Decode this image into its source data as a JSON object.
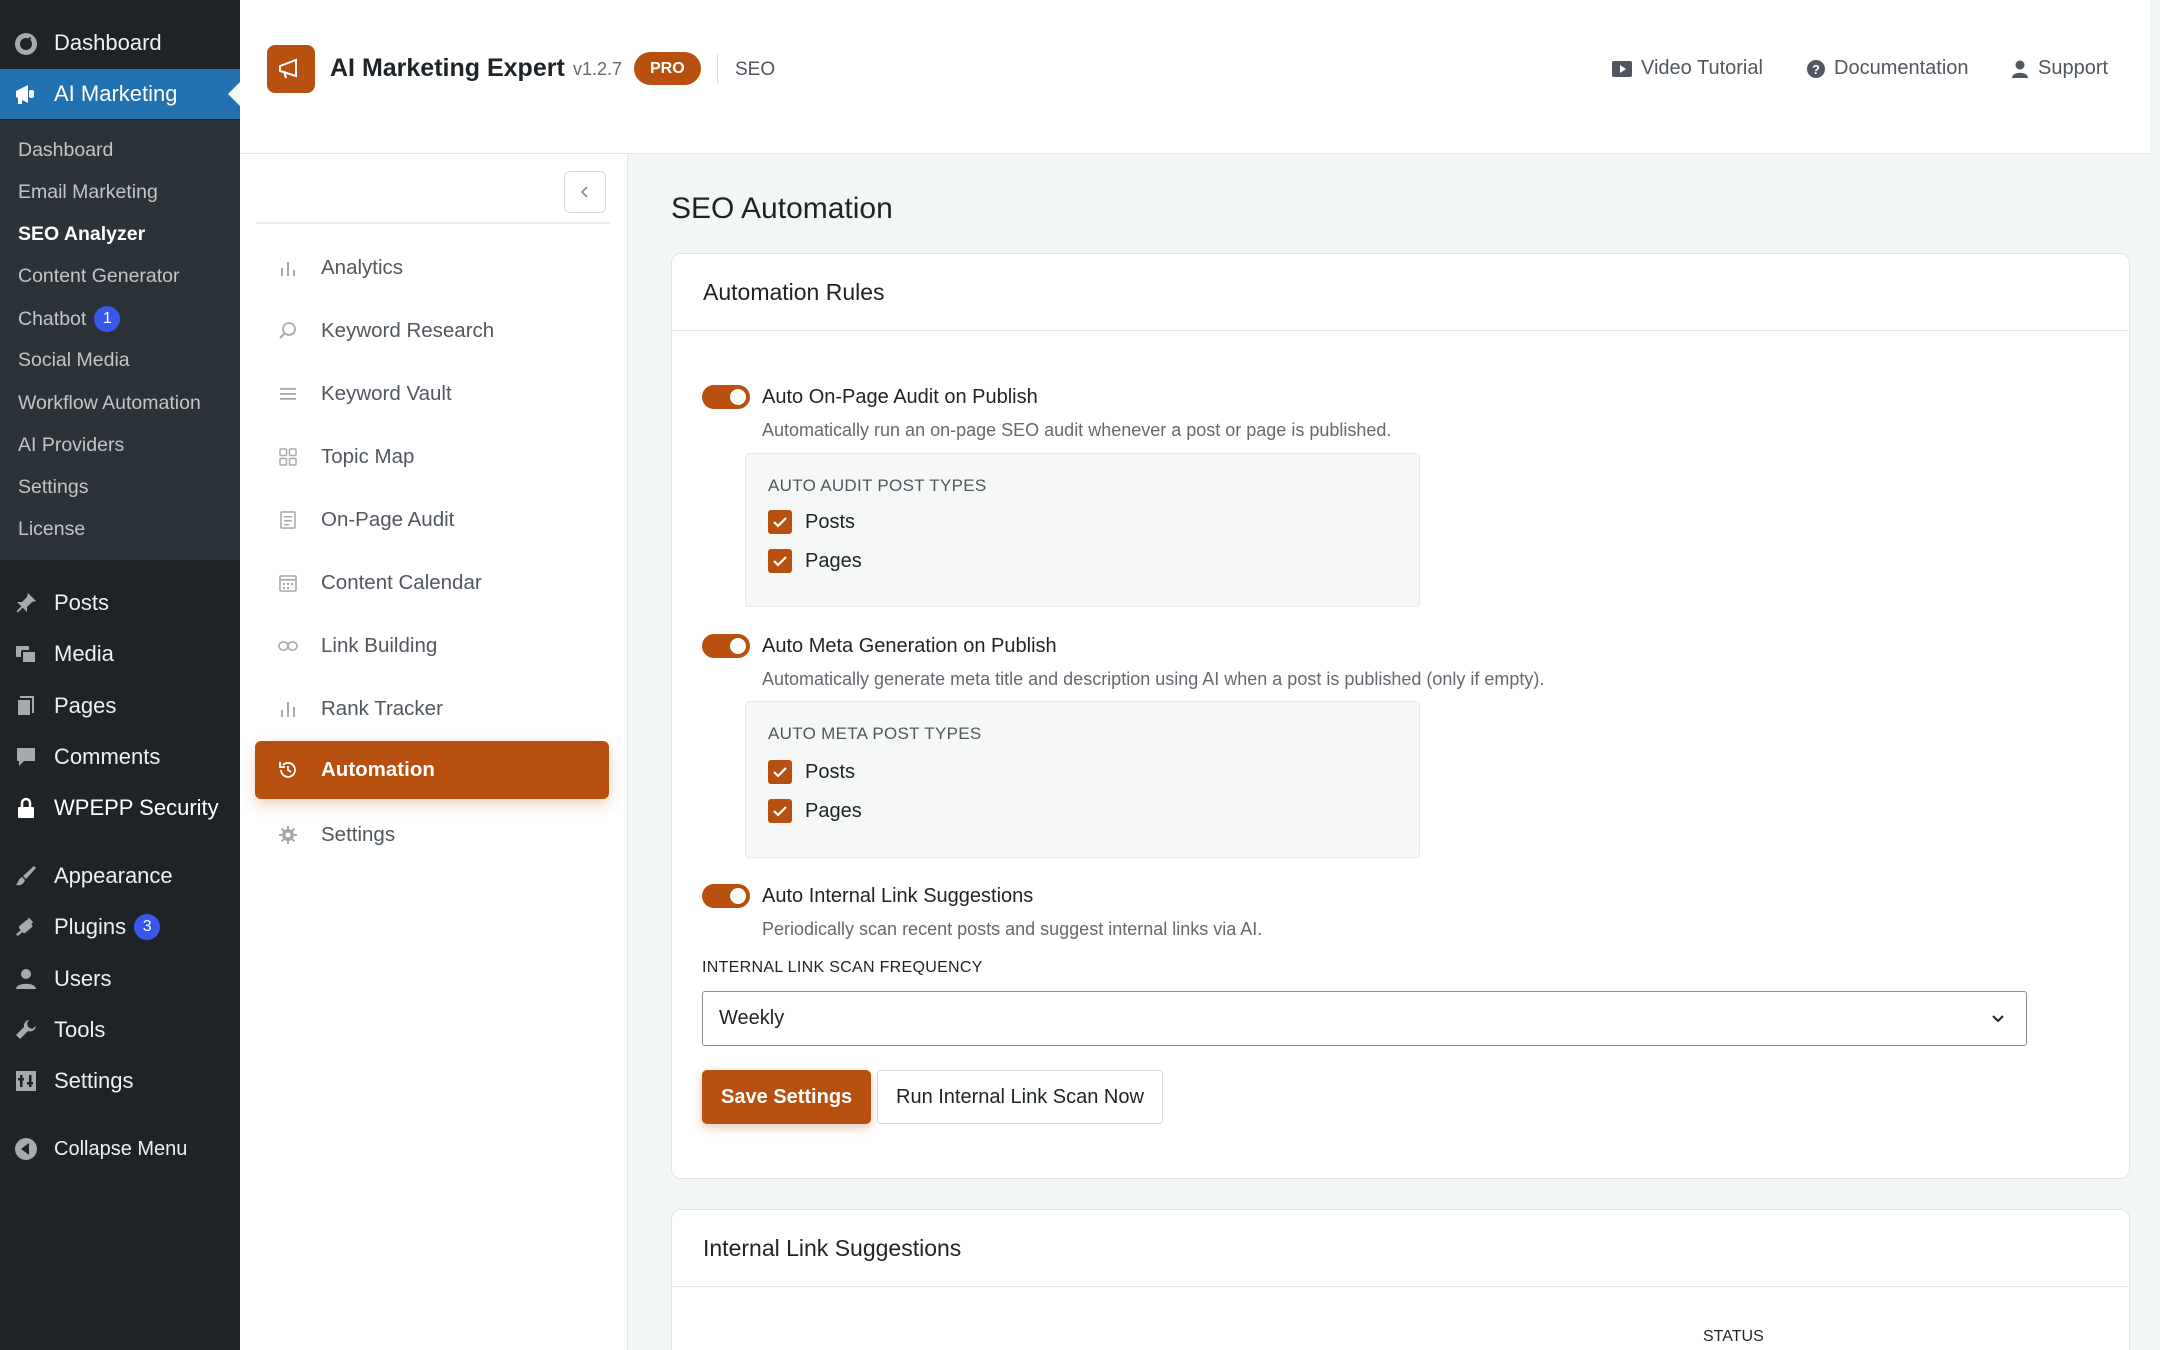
{
  "wp_menu": {
    "top": [
      {
        "label": "Dashboard",
        "icon": "dashboard-icon"
      },
      {
        "label": "AI Marketing",
        "icon": "megaphone-icon"
      }
    ],
    "submenu": [
      {
        "label": "Dashboard"
      },
      {
        "label": "Email Marketing"
      },
      {
        "label": "SEO Analyzer"
      },
      {
        "label": "Content Generator"
      },
      {
        "label": "Chatbot",
        "badge": "1"
      },
      {
        "label": "Social Media"
      },
      {
        "label": "Workflow Automation"
      },
      {
        "label": "AI Providers"
      },
      {
        "label": "Settings"
      },
      {
        "label": "License"
      }
    ],
    "bottom": [
      {
        "label": "Posts",
        "icon": "pin-icon"
      },
      {
        "label": "Media",
        "icon": "media-icon"
      },
      {
        "label": "Pages",
        "icon": "pages-icon"
      },
      {
        "label": "Comments",
        "icon": "comments-icon"
      },
      {
        "label": "WPEPP Security",
        "icon": "lock-icon"
      },
      {
        "label": "Appearance",
        "icon": "brush-icon"
      },
      {
        "label": "Plugins",
        "icon": "plugin-icon",
        "badge": "3"
      },
      {
        "label": "Users",
        "icon": "user-icon"
      },
      {
        "label": "Tools",
        "icon": "wrench-icon"
      },
      {
        "label": "Settings",
        "icon": "settings-icon"
      },
      {
        "label": "Collapse Menu",
        "icon": "collapse-icon"
      }
    ]
  },
  "header": {
    "app_name": "AI Marketing Expert",
    "version": "v1.2.7",
    "pro_badge": "PRO",
    "section": "SEO",
    "links": [
      {
        "label": "Video Tutorial",
        "icon": "video-icon"
      },
      {
        "label": "Documentation",
        "icon": "help-icon"
      },
      {
        "label": "Support",
        "icon": "support-icon"
      }
    ]
  },
  "plugin_nav": {
    "items": [
      {
        "label": "Analytics",
        "icon": "bar-chart-icon"
      },
      {
        "label": "Keyword Research",
        "icon": "search-icon"
      },
      {
        "label": "Keyword Vault",
        "icon": "list-icon"
      },
      {
        "label": "Topic Map",
        "icon": "grid-icon"
      },
      {
        "label": "On-Page Audit",
        "icon": "document-icon"
      },
      {
        "label": "Content Calendar",
        "icon": "calendar-icon"
      },
      {
        "label": "Link Building",
        "icon": "link-icon"
      },
      {
        "label": "Rank Tracker",
        "icon": "rank-icon"
      },
      {
        "label": "Automation",
        "icon": "history-icon"
      },
      {
        "label": "Settings",
        "icon": "gear-icon"
      }
    ]
  },
  "main": {
    "title": "SEO Automation",
    "rules_card": {
      "title": "Automation Rules",
      "audit": {
        "label": "Auto On-Page Audit on Publish",
        "description": "Automatically run an on-page SEO audit whenever a post or page is published.",
        "types_title": "AUTO AUDIT POST TYPES",
        "types": [
          "Posts",
          "Pages"
        ]
      },
      "meta": {
        "label": "Auto Meta Generation on Publish",
        "description": "Automatically generate meta title and description using AI when a post is published (only if empty).",
        "types_title": "AUTO META POST TYPES",
        "types": [
          "Posts",
          "Pages"
        ]
      },
      "links": {
        "label": "Auto Internal Link Suggestions",
        "description": "Periodically scan recent posts and suggest internal links via AI."
      },
      "frequency_label": "INTERNAL LINK SCAN FREQUENCY",
      "frequency_value": "Weekly",
      "save_button": "Save Settings",
      "scan_button": "Run Internal Link Scan Now"
    },
    "suggestions_card": {
      "title": "Internal Link Suggestions",
      "status_header": "STATUS"
    }
  },
  "colors": {
    "accent": "#b8510f",
    "wp_blue": "#2271b1",
    "wp_sidebar": "#1d2327"
  }
}
